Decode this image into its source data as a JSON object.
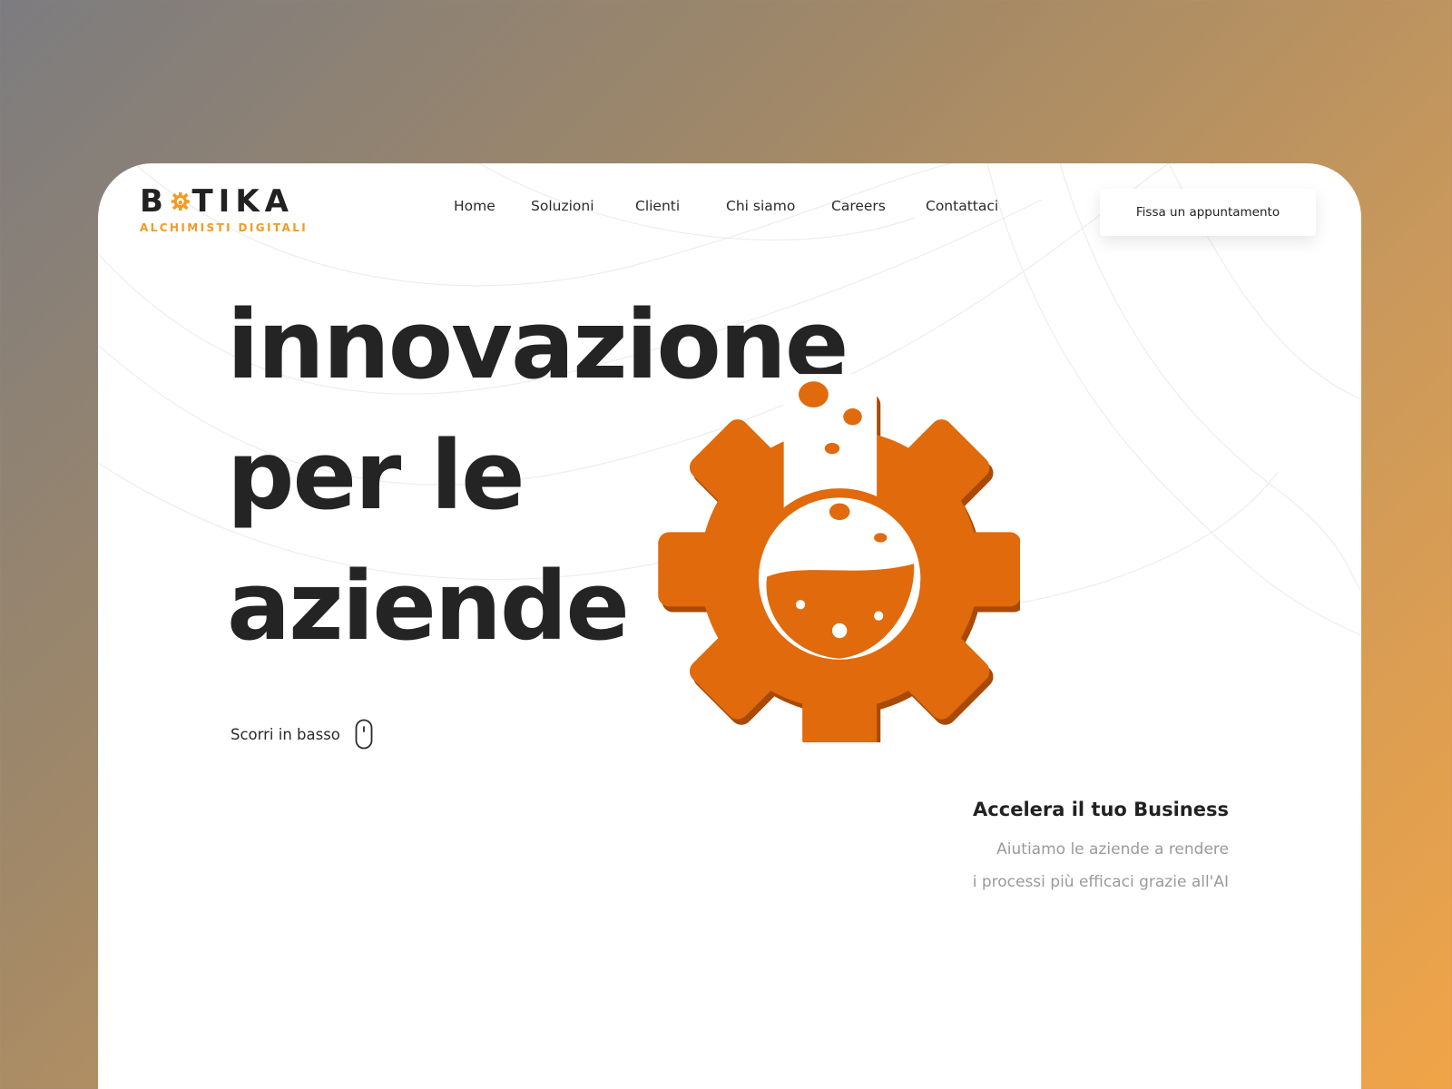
{
  "brand": {
    "name_before": "B",
    "name_after": "TIKA",
    "tagline": "ALCHIMISTI DIGITALI",
    "accent_color": "#e06a0c",
    "logo_accent_color": "#f49a24"
  },
  "nav": {
    "items": [
      {
        "label": "Home"
      },
      {
        "label": "Soluzioni"
      },
      {
        "label": "Clienti"
      },
      {
        "label": "Chi siamo"
      },
      {
        "label": "Careers"
      },
      {
        "label": "Contattaci"
      }
    ],
    "cta_label": "Fissa un appuntamento"
  },
  "hero": {
    "lines": [
      "innovazione",
      "per le",
      "aziende"
    ],
    "illustration_icon": "gear-flask-icon"
  },
  "scroll": {
    "label": "Scorri in basso",
    "icon": "mouse-icon"
  },
  "promo": {
    "title": "Accelera il tuo Business",
    "line1": "Aiutiamo le aziende a rendere",
    "line2": "i processi più efficaci grazie all'AI"
  }
}
